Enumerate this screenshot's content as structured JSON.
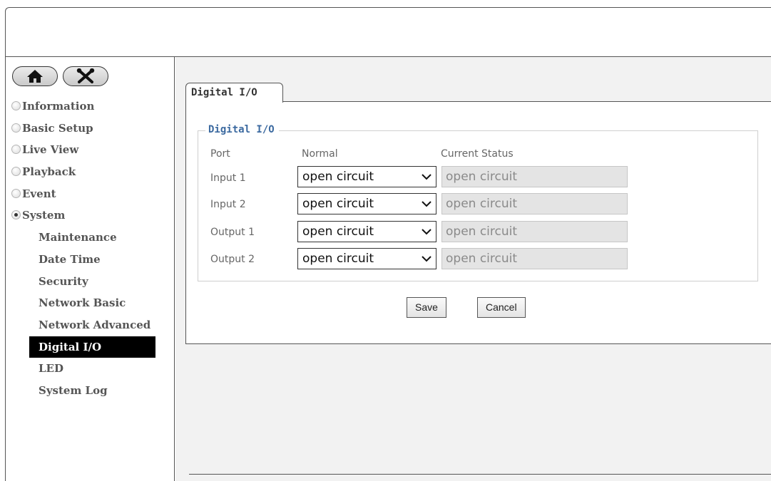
{
  "toolbar": {
    "home_icon": "home-icon",
    "tools_icon": "tools-icon"
  },
  "menu": {
    "information": "Information",
    "basic_setup": "Basic Setup",
    "live_view": "Live View",
    "playback": "Playback",
    "event": "Event",
    "system": "System",
    "maintenance": "Maintenance",
    "date_time": "Date Time",
    "security": "Security",
    "network_basic": "Network Basic",
    "network_advanced": "Network Advanced",
    "digital_io": "Digital I/O",
    "led": "LED",
    "system_log": "System Log",
    "active_item": "Digital I/O"
  },
  "tab": {
    "label": "Digital I/O"
  },
  "section": {
    "legend": "Digital I/O",
    "headers": {
      "port": "Port",
      "normal": "Normal",
      "status": "Current Status"
    },
    "rows": [
      {
        "port": "Input 1",
        "normal": "open circuit",
        "status": "open circuit"
      },
      {
        "port": "Input 2",
        "normal": "open circuit",
        "status": "open circuit"
      },
      {
        "port": "Output 1",
        "normal": "open circuit",
        "status": "open circuit"
      },
      {
        "port": "Output 2",
        "normal": "open circuit",
        "status": "open circuit"
      }
    ]
  },
  "buttons": {
    "save": "Save",
    "cancel": "Cancel"
  },
  "colors": {
    "legend_text": "#3c6aa0",
    "active_menu_bg": "#000000",
    "content_bg": "#f2f2f2"
  }
}
